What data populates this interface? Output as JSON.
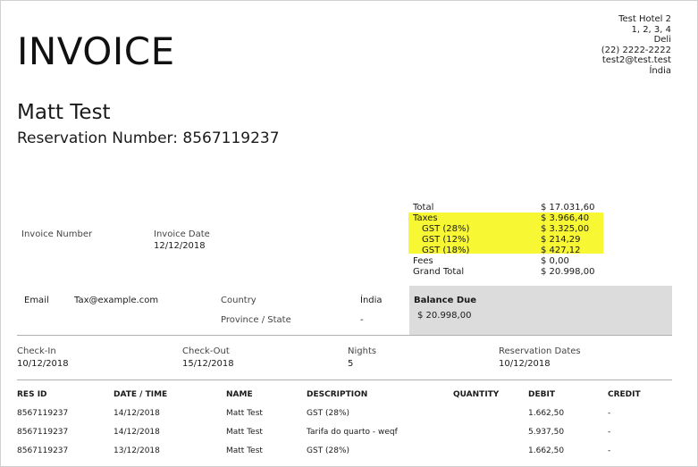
{
  "invoice": {
    "title": "INVOICE",
    "hotel": {
      "name": "Test Hotel 2",
      "address": "1, 2, 3, 4",
      "city": "Deli",
      "phone": "(22) 2222-2222",
      "email": "test2@test.test",
      "country": "Índia"
    },
    "guest_name": "Matt Test",
    "reservation_number": "Reservation Number: 8567119237",
    "invoice_number_label": "Invoice Number",
    "invoice_date_label": "Invoice Date",
    "invoice_date": "12/12/2018",
    "summary": {
      "total_label": "Total",
      "total": "$ 17.031,60",
      "taxes_label": "Taxes",
      "taxes": "$ 3.966,40",
      "gst28_label": "GST (28%)",
      "gst28": "$ 3.325,00",
      "gst12_label": "GST (12%)",
      "gst12": "$ 214,29",
      "gst18_label": "GST (18%)",
      "gst18": "$ 427,12",
      "fees_label": "Fees",
      "fees": "$ 0,00",
      "grand_total_label": "Grand Total",
      "grand_total": "$ 20.998,00",
      "highlight_color": "#f7f733"
    },
    "contact": {
      "email_label": "Email",
      "email": "Tax@example.com",
      "country_label": "Country",
      "country": "Índia",
      "province_label": "Province / State",
      "province": "-"
    },
    "balance": {
      "label": "Balance Due",
      "value": "$ 20.998,00"
    },
    "stay": {
      "checkin_label": "Check-In",
      "checkin": "10/12/2018",
      "checkout_label": "Check-Out",
      "checkout": "15/12/2018",
      "nights_label": "Nights",
      "nights": "5",
      "resdates_label": "Reservation Dates",
      "resdates": "10/12/2018"
    },
    "table": {
      "headers": [
        "RES ID",
        "DATE / TIME",
        "NAME",
        "DESCRIPTION",
        "QUANTITY",
        "DEBIT",
        "CREDIT"
      ],
      "rows": [
        [
          "8567119237",
          "14/12/2018",
          "Matt Test",
          "GST (28%)",
          "",
          "1.662,50",
          "-"
        ],
        [
          "8567119237",
          "14/12/2018",
          "Matt Test",
          "Tarifa do quarto - weqf",
          "",
          "5.937,50",
          "-"
        ],
        [
          "8567119237",
          "13/12/2018",
          "Matt Test",
          "GST (28%)",
          "",
          "1.662,50",
          "-"
        ]
      ]
    }
  }
}
